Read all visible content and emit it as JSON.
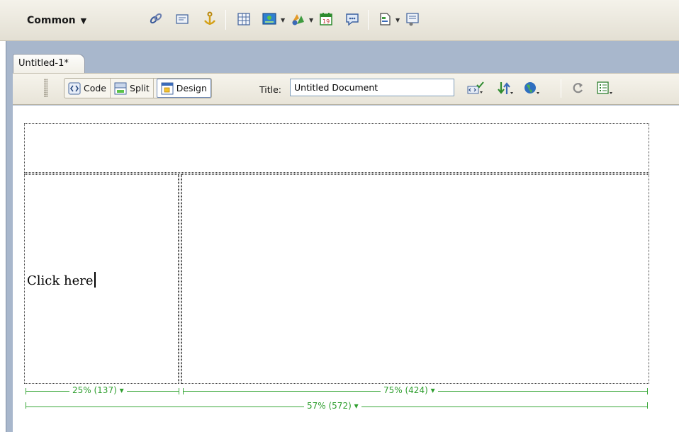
{
  "insert_bar": {
    "category": "Common",
    "category_arrow": "▼",
    "buttons": [
      {
        "name": "hyperlink-icon"
      },
      {
        "name": "email-link-icon"
      },
      {
        "name": "named-anchor-icon"
      },
      {
        "name": "table-icon"
      },
      {
        "name": "images-icon"
      },
      {
        "name": "media-icon"
      },
      {
        "name": "date-icon"
      },
      {
        "name": "comment-icon"
      },
      {
        "name": "templates-icon"
      },
      {
        "name": "tag-chooser-icon"
      }
    ]
  },
  "document": {
    "tab_title": "Untitled-1*",
    "views": {
      "code": "Code",
      "split": "Split",
      "design": "Design",
      "active": "design"
    },
    "title_label": "Title:",
    "title_value": "Untitled Document"
  },
  "canvas": {
    "cell_text": "Click here"
  },
  "rulers": {
    "left_col": "25% (137) ▾",
    "right_col": "75% (424) ▾",
    "total": "57% (572) ▾"
  }
}
